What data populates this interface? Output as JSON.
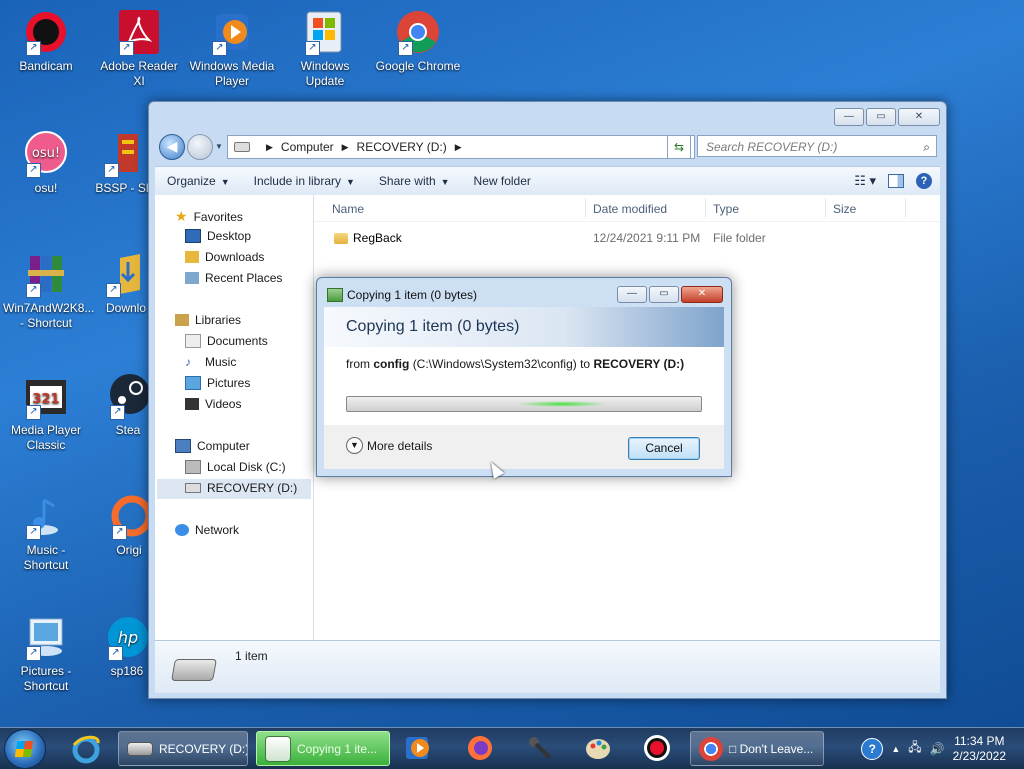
{
  "desktop_icons": [
    {
      "id": "bandicam",
      "label": "Bandicam",
      "icon": "bandicam-icon",
      "color": "#e8102a"
    },
    {
      "id": "adobe",
      "label": "Adobe Reader XI",
      "icon": "adobe-reader-icon",
      "color": "#c8102e"
    },
    {
      "id": "wmp",
      "label": "Windows Media Player",
      "icon": "media-player-icon",
      "color": "#f08a1c"
    },
    {
      "id": "wu",
      "label": "Windows Update",
      "icon": "windows-update-icon",
      "color": "#3f7fd0"
    },
    {
      "id": "chrome",
      "label": "Google Chrome",
      "icon": "chrome-icon",
      "color": "#4285f4"
    },
    {
      "id": "osu",
      "label": "osu!",
      "icon": "osu-icon",
      "color": "#ee5b8c"
    },
    {
      "id": "bssp",
      "label": "BSSP - Sh",
      "icon": "bssp-icon",
      "color": "#c0392b"
    },
    {
      "id": "winrar",
      "label": "Win7AndW2K8... - Shortcut",
      "icon": "winrar-icon",
      "color": "#7a1f8a"
    },
    {
      "id": "downloads",
      "label": "Downlo",
      "icon": "folder-icon",
      "color": "#e6b73c"
    },
    {
      "id": "mpc",
      "label": "Media Player Classic",
      "icon": "mpc-icon",
      "color": "#2a2a2a"
    },
    {
      "id": "steam",
      "label": "Stea",
      "icon": "steam-icon",
      "color": "#1b2838"
    },
    {
      "id": "music",
      "label": "Music - Shortcut",
      "icon": "music-icon",
      "color": "#3a8ee6"
    },
    {
      "id": "origin",
      "label": "Origi",
      "icon": "origin-icon",
      "color": "#f56c2d"
    },
    {
      "id": "pictures",
      "label": "Pictures - Shortcut",
      "icon": "pictures-icon",
      "color": "#5aa7e0"
    },
    {
      "id": "sp",
      "label": "sp186",
      "icon": "hp-icon",
      "color": "#0096d6"
    }
  ],
  "explorer": {
    "window_buttons": {
      "minimize": "—",
      "maximize": "▭",
      "close": "✕"
    },
    "address": {
      "parts": [
        "Computer",
        "RECOVERY (D:)"
      ]
    },
    "search_placeholder": "Search RECOVERY (D:)",
    "toolbar": [
      "Organize",
      "Include in library",
      "Share with",
      "New folder"
    ],
    "nav": {
      "favorites": {
        "label": "Favorites",
        "items": [
          "Desktop",
          "Downloads",
          "Recent Places"
        ]
      },
      "libraries": {
        "label": "Libraries",
        "items": [
          "Documents",
          "Music",
          "Pictures",
          "Videos"
        ]
      },
      "computer": {
        "label": "Computer",
        "items": [
          "Local Disk (C:)",
          "RECOVERY (D:)"
        ]
      },
      "network": {
        "label": "Network"
      }
    },
    "columns": [
      "Name",
      "Date modified",
      "Type",
      "Size"
    ],
    "rows": [
      {
        "name": "RegBack",
        "date": "12/24/2021 9:11 PM",
        "type": "File folder",
        "size": ""
      }
    ],
    "status": "1 item"
  },
  "copy_dialog": {
    "title": "Copying 1 item (0 bytes)",
    "heading": "Copying 1 item (0 bytes)",
    "from_prefix": "from",
    "from_name": "config",
    "from_path": "(C:\\Windows\\System32\\config)",
    "to_prefix": "to",
    "to_name": "RECOVERY (D:)",
    "more_details": "More details",
    "cancel": "Cancel"
  },
  "taskbar": {
    "buttons": [
      {
        "id": "explorer",
        "label": "RECOVERY (D:)",
        "state": "open"
      },
      {
        "id": "copying",
        "label": "Copying 1 ite...",
        "state": "active"
      },
      {
        "id": "chrome",
        "label": "□ Don't Leave...",
        "state": "open"
      }
    ],
    "clock": {
      "time": "11:34 PM",
      "date": "2/23/2022"
    }
  }
}
